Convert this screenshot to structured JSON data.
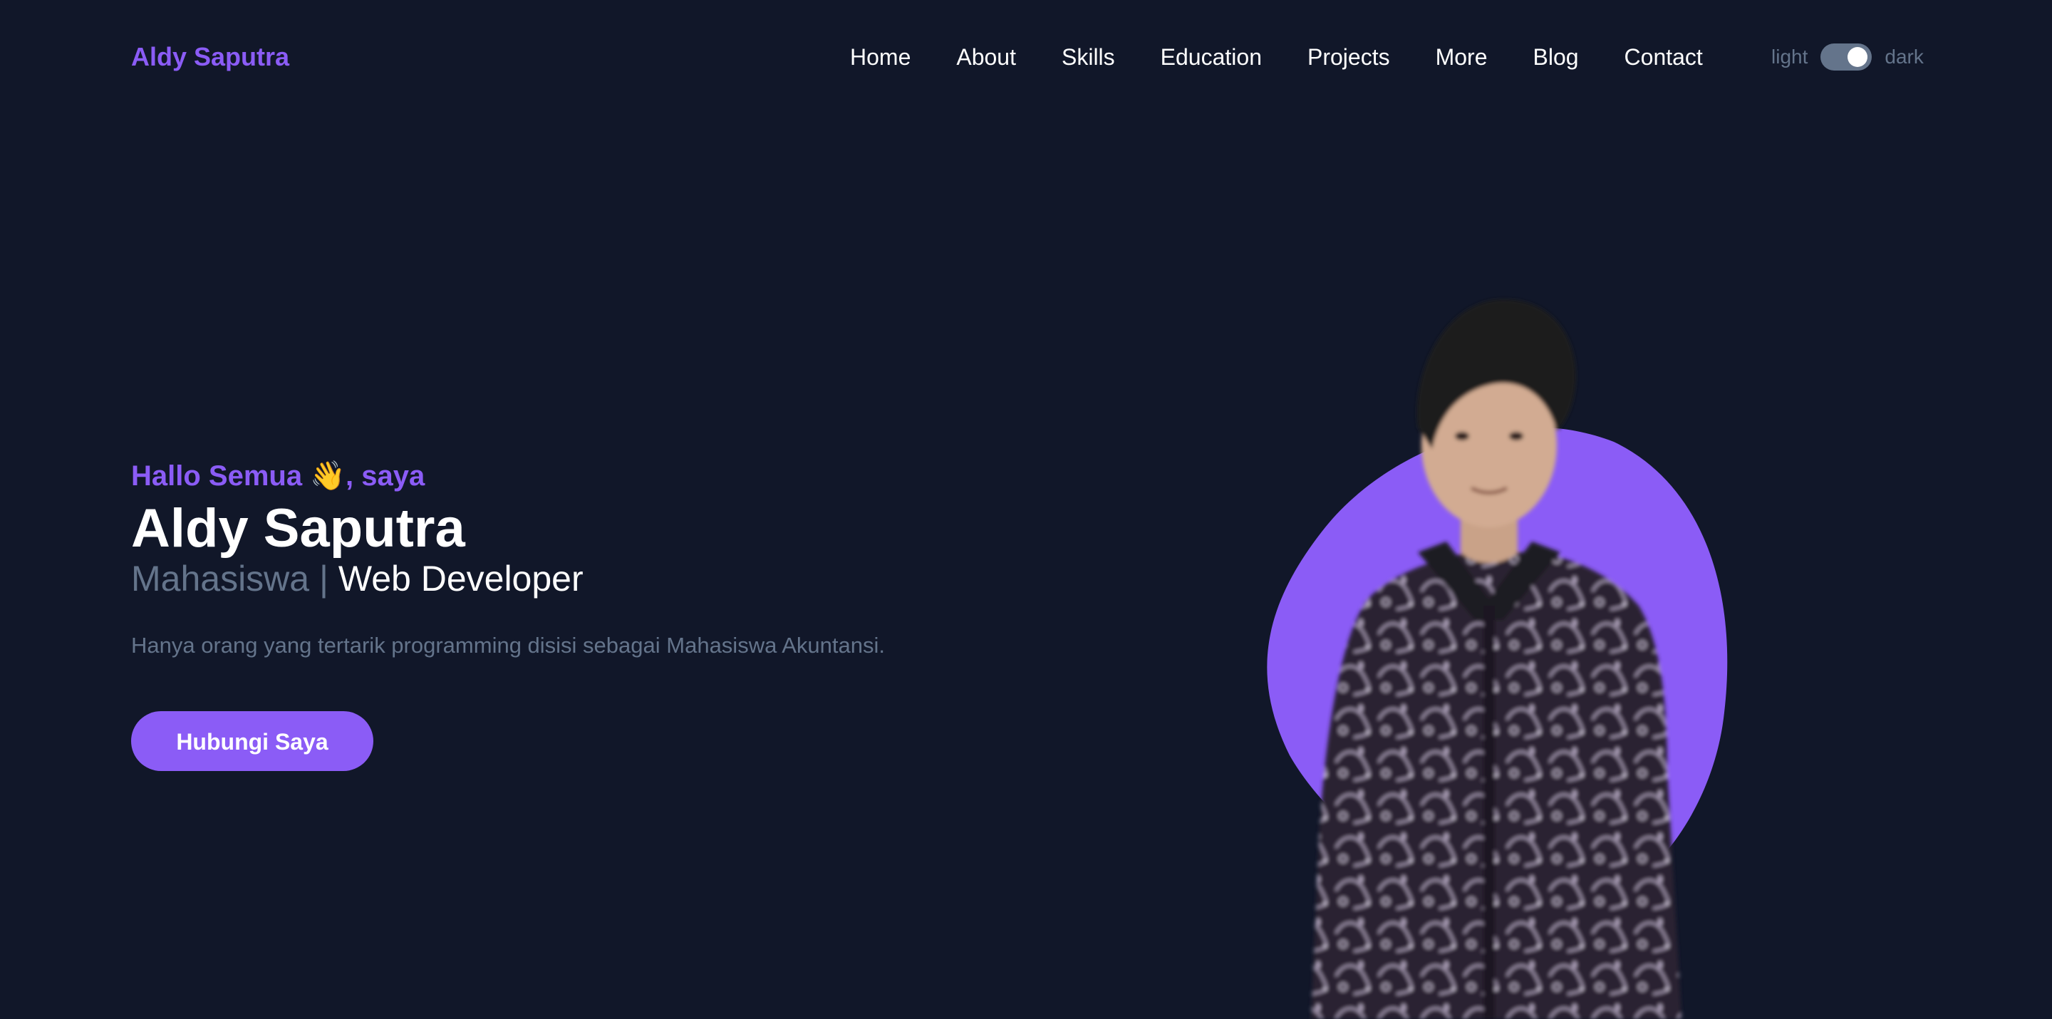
{
  "navbar": {
    "brand": "Aldy Saputra",
    "links": [
      {
        "label": "Home"
      },
      {
        "label": "About"
      },
      {
        "label": "Skills"
      },
      {
        "label": "Education"
      },
      {
        "label": "Projects"
      },
      {
        "label": "More"
      },
      {
        "label": "Blog"
      },
      {
        "label": "Contact"
      }
    ],
    "theme": {
      "light_label": "light",
      "dark_label": "dark",
      "current": "dark"
    }
  },
  "hero": {
    "greeting_text": "Hallo Semua",
    "greeting_emoji": "👋",
    "greeting_suffix": ", saya",
    "name": "Aldy Saputra",
    "role_primary": "Mahasiswa",
    "role_separator": "|",
    "role_secondary": "Web Developer",
    "tagline": "Hanya orang yang tertarik programming disisi sebagai Mahasiswa Akuntansi.",
    "cta_label": "Hubungi Saya"
  },
  "colors": {
    "background": "#111729",
    "accent": "#8b5cf6",
    "muted": "#64748b",
    "text": "#ffffff"
  },
  "icons": {
    "greeting": "waving-hand-icon"
  }
}
